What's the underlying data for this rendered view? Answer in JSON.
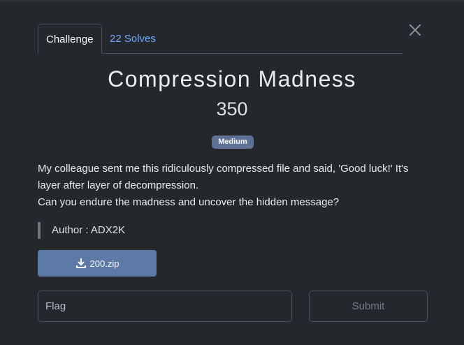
{
  "tabs": [
    {
      "label": "Challenge",
      "active": true
    },
    {
      "label": "22 Solves",
      "active": false
    }
  ],
  "challenge": {
    "title": "Compression Madness",
    "points": "350",
    "difficulty": "Medium",
    "description": [
      "My colleague sent me this ridiculously compressed file and said, 'Good luck!' It's layer after layer of decompression.",
      "Can you endure the madness and uncover the hidden message?"
    ],
    "author": "Author : ADX2K",
    "file": "200.zip",
    "file_icon": "download-icon"
  },
  "form": {
    "flag_placeholder": "Flag",
    "submit_label": "Submit"
  },
  "colors": {
    "background": "#24282d",
    "badge": "#5f7194",
    "download_button": "#5d7aa7",
    "tab_link": "#6ea8fe"
  }
}
